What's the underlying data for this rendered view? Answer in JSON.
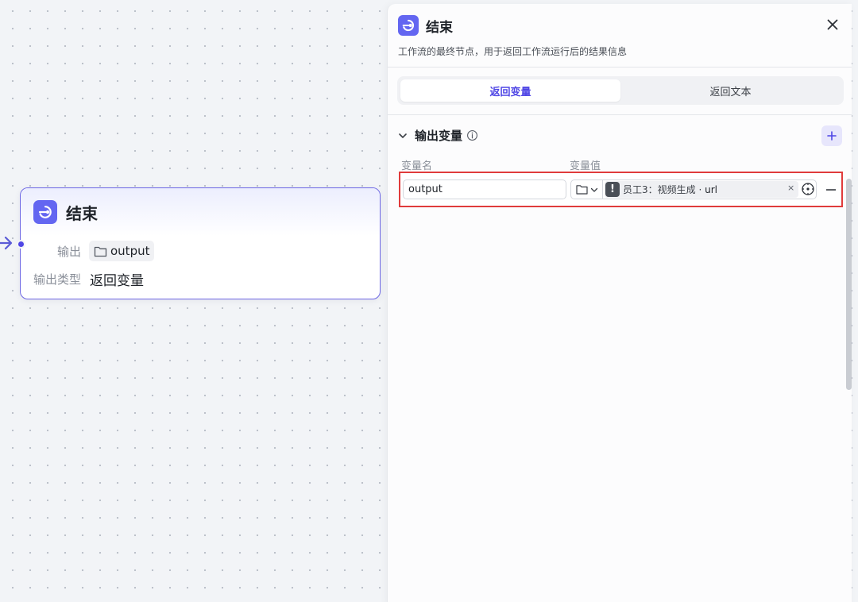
{
  "canvas": {
    "node": {
      "title": "结束",
      "icon": "end-node-icon",
      "output_label": "输出",
      "output_value": "output",
      "output_type_label": "输出类型",
      "output_type_value": "返回变量"
    }
  },
  "panel": {
    "title": "结束",
    "description": "工作流的最终节点，用于返回工作流运行后的结果信息",
    "tabs": [
      {
        "label": "返回变量",
        "active": true
      },
      {
        "label": "返回文本",
        "active": false
      }
    ],
    "section": {
      "title": "输出变量",
      "columns": {
        "name": "变量名",
        "value": "变量值"
      },
      "rows": [
        {
          "name": "output",
          "reference_prefix": "员工3：视频生成 · ",
          "reference_path": "url",
          "warning": "!"
        }
      ]
    },
    "clear_symbol": "×"
  },
  "colors": {
    "accent": "#6366f1",
    "highlight_border": "#e03b3b",
    "canvas_bg": "#f2f4f7"
  }
}
